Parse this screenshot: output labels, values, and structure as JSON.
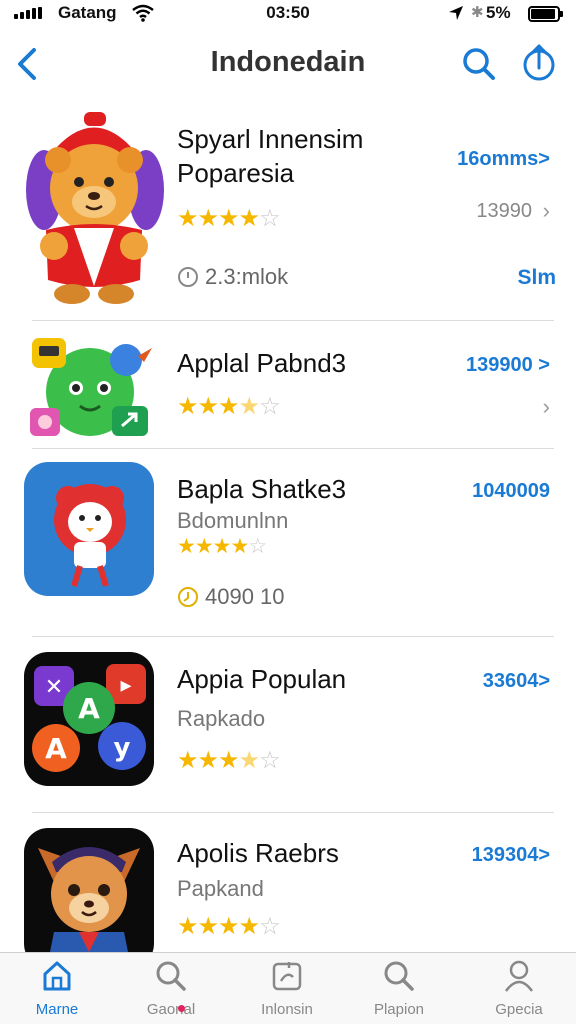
{
  "status": {
    "carrier": "Gatang",
    "time": "03:50",
    "battery": "5%"
  },
  "nav": {
    "title": "Indonedain"
  },
  "apps": [
    {
      "name": "Spyarl Innensim Poparesia",
      "price": "16omms>",
      "count": "13990",
      "meta": "2.3:mlok",
      "action": "Slm",
      "rating": 4
    },
    {
      "name": "Applal Pabnd3",
      "price": "139900 >",
      "rating": 3.5
    },
    {
      "name": "Bapla Shatke3",
      "subtitle": "Bdomunlnn",
      "price": "1040009",
      "meta": "4090 10",
      "rating": 4
    },
    {
      "name": "Appia Populan",
      "subtitle": "Rapkado",
      "price": "33604>",
      "rating": 3.5
    },
    {
      "name": "Apolis Raebrs",
      "subtitle": "Papkand",
      "price": "139304>",
      "rating": 4
    }
  ],
  "tabs": [
    {
      "label": "Marne",
      "icon": "home-icon",
      "active": true
    },
    {
      "label": "Gaonal",
      "icon": "search-icon"
    },
    {
      "label": "Inlonsin",
      "icon": "apps-icon"
    },
    {
      "label": "Plapion",
      "icon": "search-icon"
    },
    {
      "label": "Gpecia",
      "icon": "person-icon"
    }
  ],
  "colors": {
    "accent": "#1a7ad4",
    "star": "#f5b700"
  }
}
